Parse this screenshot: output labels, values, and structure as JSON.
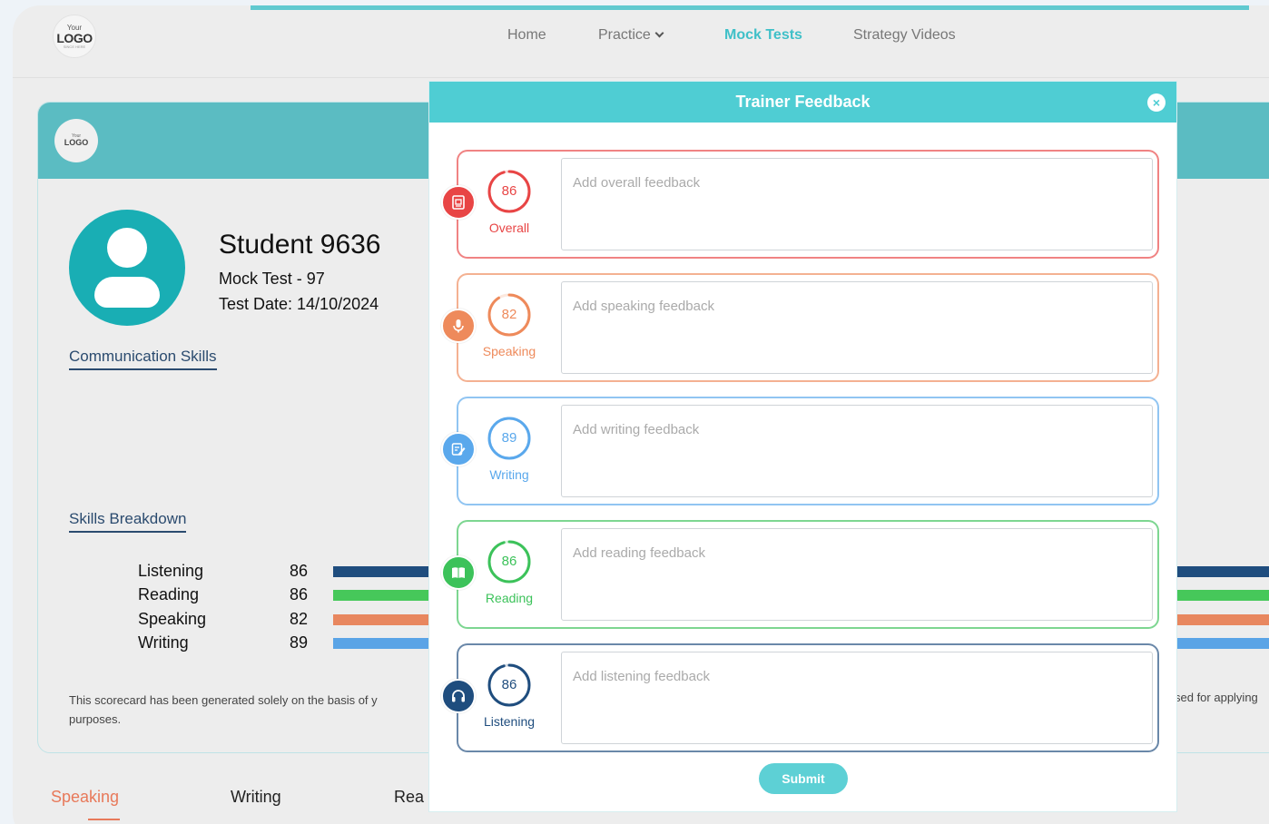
{
  "header": {
    "logo": {
      "top": "Your",
      "main": "LOGO",
      "tagline": "SINCE HERE"
    },
    "nav": [
      {
        "label": "Home",
        "active": false
      },
      {
        "label": "Practice",
        "active": false
      },
      {
        "label": "Mock Tests",
        "active": true
      },
      {
        "label": "Strategy Videos",
        "active": false
      }
    ]
  },
  "scorecard": {
    "band_logo": {
      "top": "Your",
      "main": "LOGO"
    },
    "student_name": "Student 9636",
    "mock_test": "Mock Test - 97",
    "test_date": "Test Date: 14/10/2024",
    "communication_title": "Communication Skills",
    "breakdown_title": "Skills Breakdown",
    "skills": [
      {
        "name": "Listening",
        "value": "86",
        "color": "#1f4d7e"
      },
      {
        "name": "Reading",
        "value": "86",
        "color": "#46c85a"
      },
      {
        "name": "Speaking",
        "value": "82",
        "color": "#e8875f"
      },
      {
        "name": "Writing",
        "value": "89",
        "color": "#5aa4e6"
      }
    ],
    "disclaimer_line1": "This scorecard has been generated solely on the basis of y",
    "disclaimer_line2": "purposes.",
    "disclaimer_right": "sed for applying"
  },
  "bottom_tabs": [
    {
      "label": "Speaking",
      "active": true
    },
    {
      "label": "Writing",
      "active": false
    },
    {
      "label": "Rea",
      "active": false
    }
  ],
  "modal": {
    "title": "Trainer Feedback",
    "close_icon": "×",
    "submit_label": "Submit",
    "rows": [
      {
        "key": "overall",
        "score": 86,
        "max": 90,
        "label": "Overall",
        "placeholder": "Add overall feedback",
        "color": "#e84545",
        "icon": "document-icon"
      },
      {
        "key": "speaking",
        "score": 82,
        "max": 90,
        "label": "Speaking",
        "placeholder": "Add speaking feedback",
        "color": "#ee8a5b",
        "icon": "microphone-icon"
      },
      {
        "key": "writing",
        "score": 89,
        "max": 90,
        "label": "Writing",
        "placeholder": "Add writing feedback",
        "color": "#5aa8ec",
        "icon": "pen-icon"
      },
      {
        "key": "reading",
        "score": 86,
        "max": 90,
        "label": "Reading",
        "placeholder": "Add reading feedback",
        "color": "#3cc25a",
        "icon": "book-icon"
      },
      {
        "key": "listening",
        "score": 86,
        "max": 90,
        "label": "Listening",
        "placeholder": "Add listening feedback",
        "color": "#1f4d7e",
        "icon": "headphones-icon"
      }
    ]
  }
}
